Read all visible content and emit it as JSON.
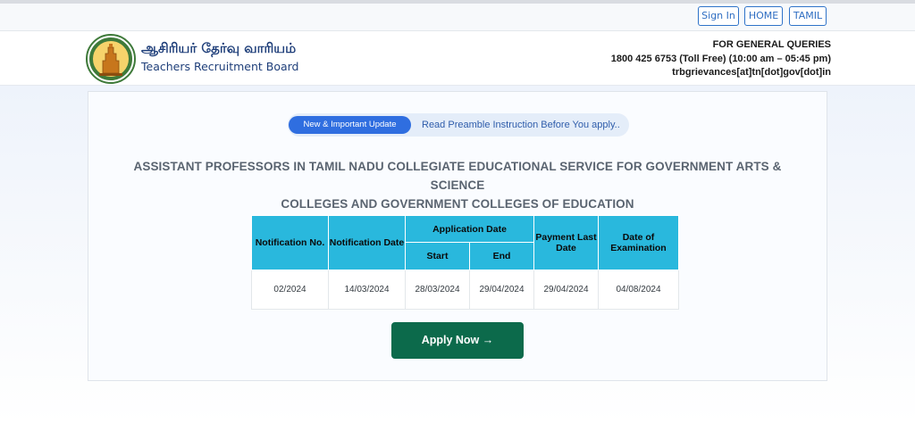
{
  "topbar": {
    "sign_in": "Sign In",
    "home": "HOME",
    "tamil": "TAMIL"
  },
  "brand": {
    "name_tamil": "ஆசிரியர் தேர்வு வாரியம்",
    "name_english": "Teachers Recruitment Board",
    "logo_icon": "tamil-nadu-emblem-icon"
  },
  "contact": {
    "heading": "FOR GENERAL QUERIES",
    "phone": "1800 425 6753 (Toll Free)  (10:00 am – 05:45 pm)",
    "email": "trbgrievances[at]tn[dot]gov[dot]in"
  },
  "notice": {
    "badge": "New & Important Update",
    "link": "Read Preamble Instruction Before You apply.."
  },
  "title": {
    "line1": "ASSISTANT PROFESSORS IN TAMIL NADU COLLEGIATE EDUCATIONAL SERVICE FOR GOVERNMENT ARTS & SCIENCE",
    "line2": "COLLEGES AND GOVERNMENT COLLEGES OF EDUCATION"
  },
  "table": {
    "headers": {
      "notification_no": "Notification No.",
      "notification_date": "Notification Date",
      "application_date": "Application Date",
      "start": "Start",
      "end": "End",
      "payment_last_date": "Payment Last Date",
      "date_of_examination": "Date of Examination"
    },
    "row": {
      "notification_no": "02/2024",
      "notification_date": "14/03/2024",
      "start": "28/03/2024",
      "end": "29/04/2024",
      "payment_last_date": "29/04/2024",
      "date_of_examination": "04/08/2024"
    }
  },
  "apply_button": {
    "label": "Apply Now",
    "icon": "→"
  },
  "colors": {
    "accent_blue": "#2f6ee0",
    "table_header": "#29b8dd",
    "apply_green": "#0c6a4b",
    "brand_navy": "#1f3f7a"
  }
}
